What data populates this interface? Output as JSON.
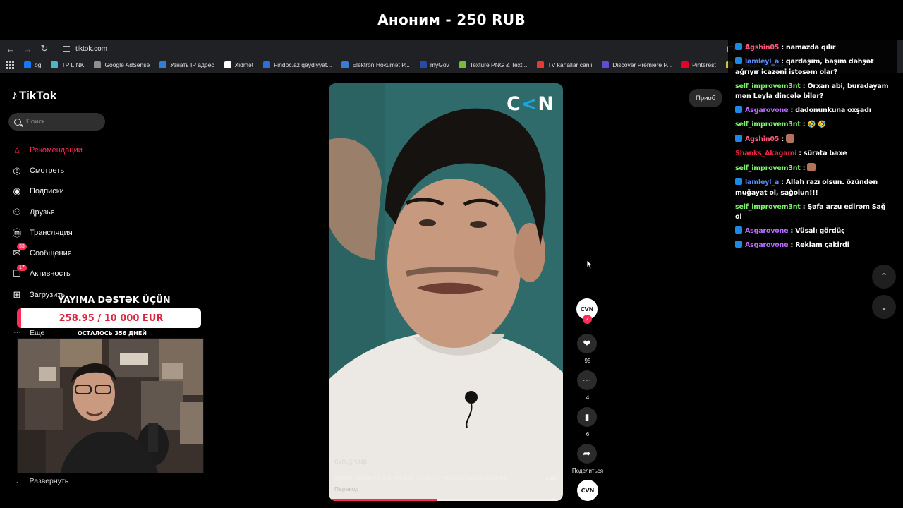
{
  "banner": {
    "title": "Аноним - 250 RUB"
  },
  "browser": {
    "url": "tiktok.com",
    "bookmarks": [
      {
        "label": "og",
        "color": "#1877f2"
      },
      {
        "label": "TP LINK",
        "color": "#4bb6c9"
      },
      {
        "label": "Google AdSense",
        "color": "#8f8f8f"
      },
      {
        "label": "Узнать IP адрес",
        "color": "#2f7fd6"
      },
      {
        "label": "Xidmət",
        "color": "#ffffff"
      },
      {
        "label": "Findoc.az qeydiyyat...",
        "color": "#2b6fd6"
      },
      {
        "label": "Elektron Hökumət P...",
        "color": "#3a7bd5"
      },
      {
        "label": "myGov",
        "color": "#2a4aa8"
      },
      {
        "label": "Texture PNG & Text...",
        "color": "#6fbf3a"
      },
      {
        "label": "TV kanallar canli",
        "color": "#e53935"
      },
      {
        "label": "Discover Premiere P...",
        "color": "#5b4dd6"
      },
      {
        "label": "Pinterest",
        "color": "#e60023"
      },
      {
        "label": "Словарь игровых т...",
        "color": "#d4c43a"
      }
    ]
  },
  "sidebar": {
    "logo": "TikTok",
    "search_placeholder": "Поиск",
    "nav": [
      {
        "label": "Рекомендации",
        "icon": "home-icon",
        "active": true
      },
      {
        "label": "Смотреть",
        "icon": "compass-icon"
      },
      {
        "label": "Подписки",
        "icon": "following-avatar-icon"
      },
      {
        "label": "Друзья",
        "icon": "friends-icon"
      },
      {
        "label": "Трансляция",
        "icon": "live-icon"
      },
      {
        "label": "Сообщения",
        "icon": "messages-icon",
        "badge": "33"
      },
      {
        "label": "Активность",
        "icon": "activity-icon",
        "badge": "17"
      },
      {
        "label": "Загрузить",
        "icon": "upload-icon"
      }
    ],
    "more_label": "Еще",
    "expand_label": "Развернуть"
  },
  "stream_overlay": {
    "donate_title": "YAYIMA DƏSTƏK ÜÇÜN",
    "donate_amount": "258.95 / 10 000 EUR",
    "donate_progress": 0.026,
    "days_left": "ОСТАЛОСЬ 356 ДНЕЙ"
  },
  "video": {
    "channel_logo": "CVN",
    "author": "cvn.group",
    "description": "Monitor Şirləri #3 Tam Versiya \"CVN TV\" Youtube Kanalımızda#c...",
    "more": "еще",
    "translate": "Перевод",
    "progress": 0.46
  },
  "actions": {
    "likes": "95",
    "comments": "4",
    "saves": "6",
    "share_label": "Поделиться",
    "avatar_text": "CVN"
  },
  "header_right": {
    "get_app": "Приоб"
  },
  "chat": [
    {
      "user": "Agshin05",
      "color": "#ff5a7a",
      "text": "namazda qılır",
      "badge": true
    },
    {
      "user": "lamleyl_a",
      "color": "#5b8cff",
      "text": "qardaşım, başım dəhşət ağrıyır icazəni istəsəm olar?",
      "badge": true
    },
    {
      "user": "self_improvem3nt",
      "color": "#7cf26a",
      "text": "Orxan abi, buradayam mən Leyla dincələ bilər?",
      "badge": false
    },
    {
      "user": "Asgarovone",
      "color": "#b66cff",
      "text": "dadonunkuna oxşadı",
      "badge": true
    },
    {
      "user": "self_improvem3nt",
      "color": "#7cf26a",
      "text": "🤣 🤣",
      "badge": false
    },
    {
      "user": "Agshin05",
      "color": "#ff5a7a",
      "text": "",
      "emote": true,
      "badge": true
    },
    {
      "user": "Shanks_Akagami",
      "color": "#e8253f",
      "text": "sürətə baxe",
      "badge": false
    },
    {
      "user": "self_improvem3nt",
      "color": "#7cf26a",
      "text": "",
      "emote": true,
      "badge": false
    },
    {
      "user": "lamleyl_a",
      "color": "#5b8cff",
      "text": "Allah razı olsun. özündən muğayat ol, sağolun!!!",
      "badge": true
    },
    {
      "user": "self_improvem3nt",
      "color": "#7cf26a",
      "text": "Şəfa arzu edirəm Sağ ol",
      "badge": false
    },
    {
      "user": "Asgarovone",
      "color": "#b66cff",
      "text": "Vüsalı gördüç",
      "badge": true
    },
    {
      "user": "Asgarovone",
      "color": "#b66cff",
      "text": "Reklam çakirdi",
      "badge": true
    }
  ]
}
